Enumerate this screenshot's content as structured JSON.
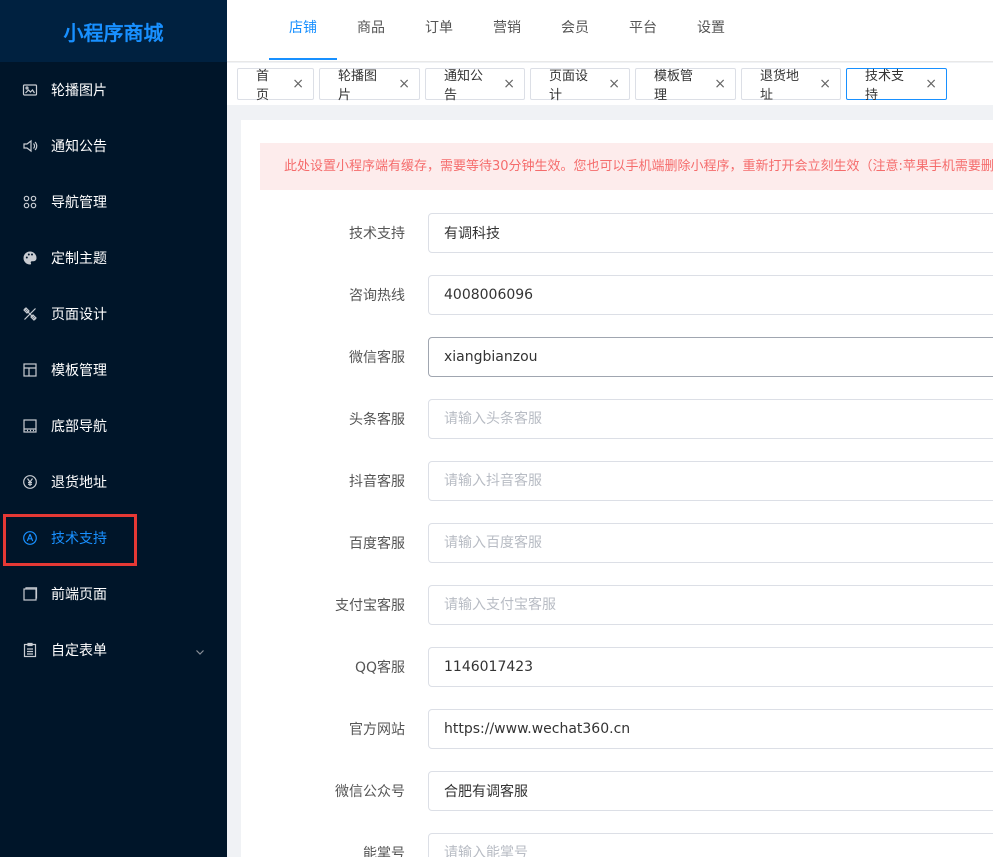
{
  "app": {
    "title": "小程序商城"
  },
  "sidebar": {
    "items": [
      {
        "label": "轮播图片",
        "icon": "image-icon"
      },
      {
        "label": "通知公告",
        "icon": "speaker-icon"
      },
      {
        "label": "导航管理",
        "icon": "grid-icon"
      },
      {
        "label": "定制主题",
        "icon": "palette-icon"
      },
      {
        "label": "页面设计",
        "icon": "design-tools-icon"
      },
      {
        "label": "模板管理",
        "icon": "template-icon"
      },
      {
        "label": "底部导航",
        "icon": "bottom-nav-icon"
      },
      {
        "label": "退货地址",
        "icon": "yen-circle-icon"
      },
      {
        "label": "技术支持",
        "icon": "support-icon",
        "active": true
      },
      {
        "label": "前端页面",
        "icon": "window-icon"
      },
      {
        "label": "自定表单",
        "icon": "clipboard-icon",
        "has_submenu": true
      }
    ]
  },
  "header": {
    "tabs": [
      {
        "label": "店铺",
        "active": true
      },
      {
        "label": "商品"
      },
      {
        "label": "订单"
      },
      {
        "label": "营销"
      },
      {
        "label": "会员"
      },
      {
        "label": "平台"
      },
      {
        "label": "设置"
      }
    ]
  },
  "tagbar": {
    "tags": [
      {
        "label": "首页"
      },
      {
        "label": "轮播图片"
      },
      {
        "label": "通知公告"
      },
      {
        "label": "页面设计"
      },
      {
        "label": "模板管理"
      },
      {
        "label": "退货地址"
      },
      {
        "label": "技术支持",
        "active": true
      }
    ],
    "close_glyph": "×"
  },
  "main": {
    "notice": "此处设置小程序端有缓存，需要等待30分钟生效。您也可以手机端删除小程序，重新打开会立刻生效（注意:苹果手机需要删除",
    "fields": [
      {
        "label": "技术支持",
        "value": "有调科技",
        "placeholder": ""
      },
      {
        "label": "咨询热线",
        "value": "4008006096",
        "placeholder": ""
      },
      {
        "label": "微信客服",
        "value": "xiangbianzou",
        "placeholder": "",
        "focused": true
      },
      {
        "label": "头条客服",
        "value": "",
        "placeholder": "请输入头条客服"
      },
      {
        "label": "抖音客服",
        "value": "",
        "placeholder": "请输入抖音客服"
      },
      {
        "label": "百度客服",
        "value": "",
        "placeholder": "请输入百度客服"
      },
      {
        "label": "支付宝客服",
        "value": "",
        "placeholder": "请输入支付宝客服"
      },
      {
        "label": "QQ客服",
        "value": "1146017423",
        "placeholder": ""
      },
      {
        "label": "官方网站",
        "value": "https://www.wechat360.cn",
        "placeholder": ""
      },
      {
        "label": "微信公众号",
        "value": "合肥有调客服",
        "placeholder": ""
      },
      {
        "label": "能掌号",
        "value": "",
        "placeholder": "请输入能掌号"
      }
    ]
  },
  "colors": {
    "sidebar_bg": "#001529",
    "accent": "#1890ff",
    "notice_text": "#f56c6c",
    "notice_bg": "#fdecec",
    "highlight": "#e53935"
  }
}
